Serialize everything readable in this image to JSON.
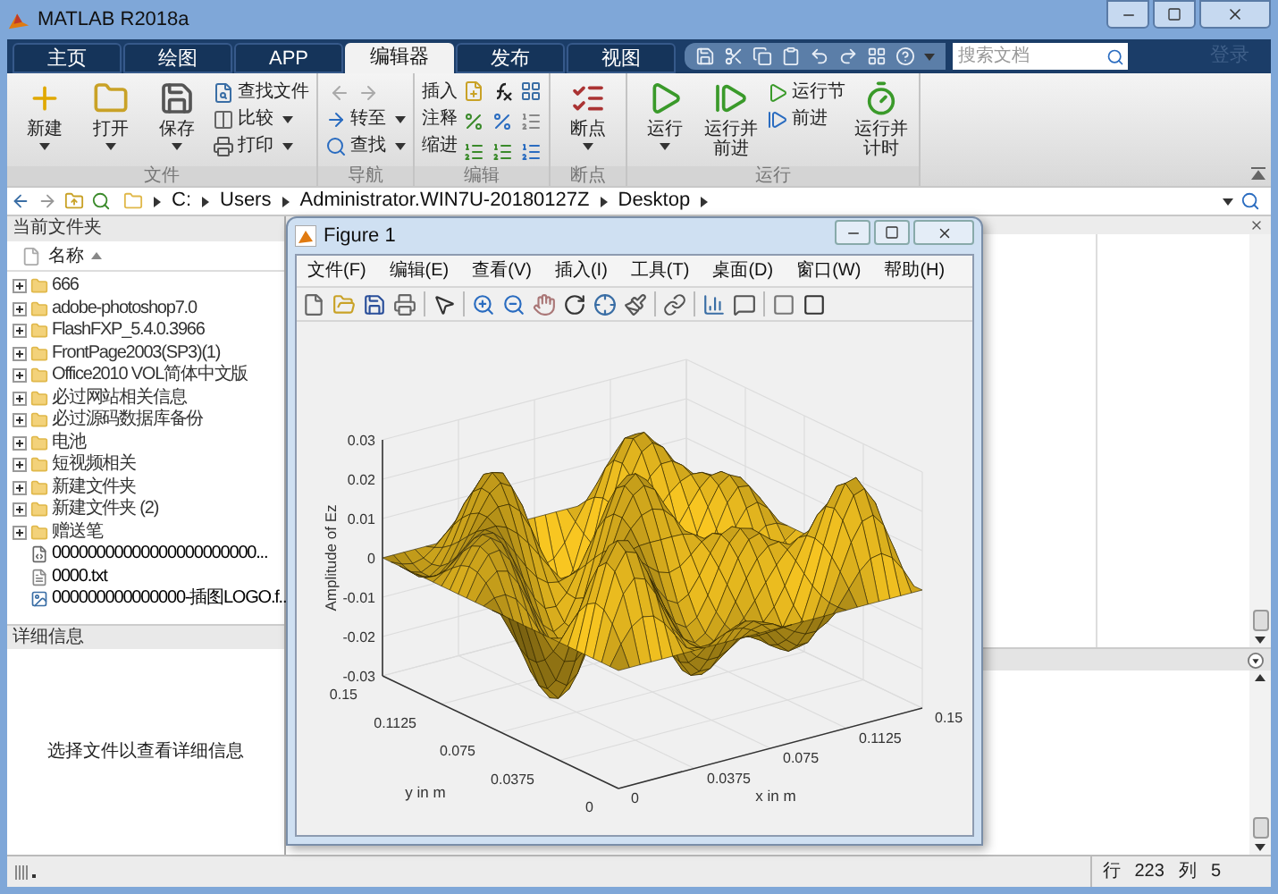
{
  "window": {
    "title": "MATLAB R2018a"
  },
  "tabs": [
    {
      "label": "主页",
      "selected": false
    },
    {
      "label": "绘图",
      "selected": false
    },
    {
      "label": "APP",
      "selected": false
    },
    {
      "label": "编辑器",
      "selected": true
    },
    {
      "label": "发布",
      "selected": false
    },
    {
      "label": "视图",
      "selected": false
    }
  ],
  "search": {
    "placeholder": "搜索文档"
  },
  "login": "登录",
  "ribbon": {
    "groups": [
      {
        "kind": "file",
        "title": "文件",
        "items": [
          {
            "kind": "big",
            "label": "新建",
            "dropdown": true
          },
          {
            "kind": "big",
            "label": "打开",
            "dropdown": true
          },
          {
            "kind": "big",
            "label": "保存",
            "dropdown": true
          },
          {
            "kind": "small",
            "label": "查找文件",
            "dropdown": false
          },
          {
            "kind": "small",
            "label": "比较",
            "dropdown": true
          },
          {
            "kind": "small",
            "label": "打印",
            "dropdown": true
          }
        ]
      },
      {
        "kind": "nav",
        "title": "导航",
        "items": [
          {
            "kind": "small",
            "label": "转至",
            "dropdown": true
          },
          {
            "kind": "small",
            "label": "查找",
            "dropdown": true
          }
        ]
      },
      {
        "kind": "edit",
        "title": "编辑",
        "items": [
          {
            "kind": "small",
            "label": "插入",
            "dropdown": false
          },
          {
            "kind": "small",
            "label": "注释",
            "dropdown": false
          },
          {
            "kind": "small",
            "label": "缩进",
            "dropdown": false
          }
        ]
      },
      {
        "kind": "breakpoint",
        "title": "断点",
        "items": [
          {
            "kind": "big",
            "label": "断点",
            "dropdown": true
          }
        ]
      },
      {
        "kind": "run",
        "title": "运行",
        "items": [
          {
            "kind": "big",
            "label": "运行",
            "dropdown": true
          },
          {
            "kind": "big",
            "label": "运行并前进",
            "dropdown": false
          },
          {
            "kind": "small",
            "label": "运行节",
            "dropdown": false
          },
          {
            "kind": "small",
            "label": "前进",
            "dropdown": false
          },
          {
            "kind": "big",
            "label": "运行并计时",
            "dropdown": false
          }
        ]
      }
    ]
  },
  "path": [
    "C:",
    "Users",
    "Administrator.WIN7U-20180127Z",
    "Desktop"
  ],
  "file_browser": {
    "title": "当前文件夹",
    "column": "名称",
    "items": [
      {
        "kind": "folder",
        "name": "666",
        "expanded": false
      },
      {
        "kind": "folder",
        "name": "adobe-photoshop7.0",
        "expanded": false
      },
      {
        "kind": "folder",
        "name": "FlashFXP_5.4.0.3966",
        "expanded": false
      },
      {
        "kind": "folder",
        "name": "FrontPage2003(SP3)(1)",
        "expanded": false
      },
      {
        "kind": "folder",
        "name": "Office2010 VOL简体中文版",
        "expanded": false
      },
      {
        "kind": "folder",
        "name": "必过网站相关信息",
        "expanded": false
      },
      {
        "kind": "folder",
        "name": "必过源码数据库备份",
        "expanded": false
      },
      {
        "kind": "folder",
        "name": "电池",
        "expanded": false
      },
      {
        "kind": "folder",
        "name": "短视频相关",
        "expanded": false
      },
      {
        "kind": "folder",
        "name": "新建文件夹",
        "expanded": false
      },
      {
        "kind": "folder",
        "name": "新建文件夹 (2)",
        "expanded": false
      },
      {
        "kind": "folder",
        "name": "赠送笔",
        "expanded": false
      },
      {
        "kind": "script",
        "name": "00000000000000000000000..."
      },
      {
        "kind": "text",
        "name": "0000.txt"
      },
      {
        "kind": "image",
        "name": "000000000000000-插图LOGO.f..."
      }
    ]
  },
  "details": {
    "title": "详细信息",
    "message": "选择文件以查看详细信息"
  },
  "figure": {
    "title": "Figure 1",
    "menu": [
      "文件(F)",
      "编辑(E)",
      "查看(V)",
      "插入(I)",
      "工具(T)",
      "桌面(D)",
      "窗口(W)",
      "帮助(H)"
    ],
    "plot": {
      "z_label": "Amplitude of Ez",
      "y_label": "y in m",
      "x_label": "x in m",
      "z_ticks": [
        "0.03",
        "0.02",
        "0.01",
        "0",
        "-0.01",
        "-0.02",
        "-0.03"
      ],
      "y_ticks": [
        "0",
        "0.0375",
        "0.075",
        "0.1125",
        "0.15"
      ],
      "x_ticks": [
        "0",
        "0.0375",
        "0.075",
        "0.1125",
        "0.15"
      ]
    }
  },
  "status_bar": {
    "row_label": "行",
    "row": "223",
    "col_label": "列",
    "col": "5"
  }
}
